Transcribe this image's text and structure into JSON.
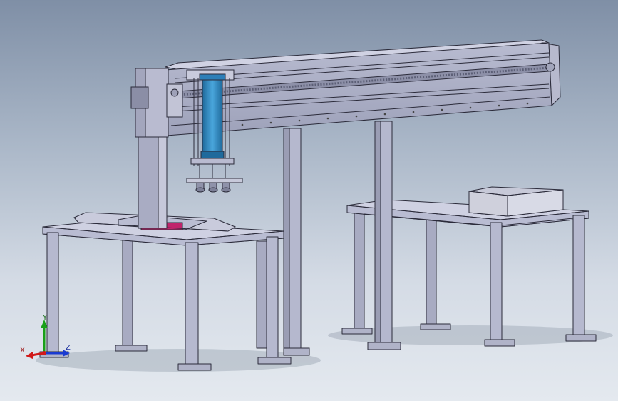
{
  "viewport": {
    "background_top": "#7f8fa6",
    "background_bottom": "#e4e9ef"
  },
  "model": {
    "part_color": "#c3c5d8",
    "shade_color": "#9a9db4",
    "edge_color": "#2b2b3a",
    "cylinder_color": "#2c7fb8",
    "accent_color": "#c0246b"
  },
  "triad": {
    "x_label": "X",
    "y_label": "Y",
    "z_label": "Z",
    "x_color": "#d11a1a",
    "y_color": "#19a019",
    "z_color": "#1a3ad1"
  }
}
